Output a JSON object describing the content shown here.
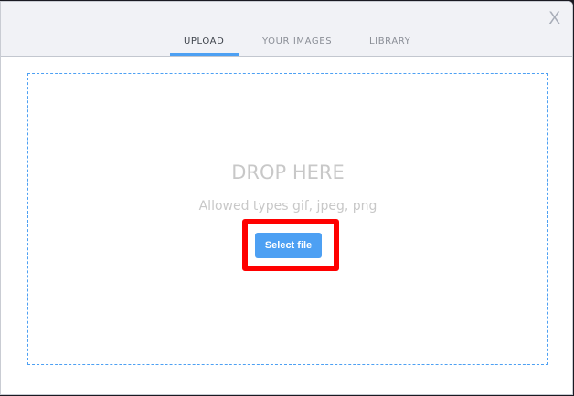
{
  "dialog": {
    "close_label": "X",
    "tabs": [
      {
        "label": "UPLOAD",
        "active": true
      },
      {
        "label": "YOUR IMAGES",
        "active": false
      },
      {
        "label": "LIBRARY",
        "active": false
      }
    ],
    "dropzone": {
      "title": "DROP HERE",
      "subtitle": "Allowed types gif, jpeg, png",
      "select_button": "Select file"
    }
  },
  "colors": {
    "accent": "#4da0f3",
    "highlight": "#ff0000",
    "header_bg": "#f1f2f6"
  }
}
